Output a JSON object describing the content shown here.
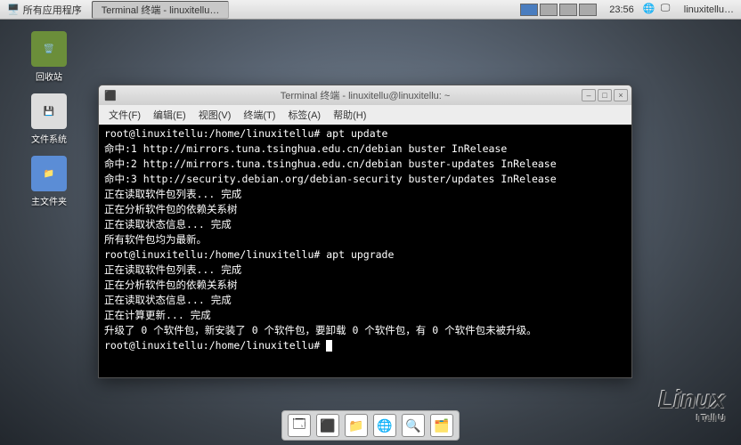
{
  "panel": {
    "apps_btn": "所有应用程序",
    "task": "Terminal 终端 - linuxitellu…",
    "clock": "23:56",
    "user": "linuxitellu…"
  },
  "desktop": {
    "trash": "回收站",
    "filesystem": "文件系统",
    "home": "主文件夹"
  },
  "window": {
    "title": "Terminal 终端 - linuxitellu@linuxitellu: ~",
    "menu": {
      "file": "文件(F)",
      "edit": "编辑(E)",
      "view": "视图(V)",
      "terminal": "终端(T)",
      "tabs": "标签(A)",
      "help": "帮助(H)"
    }
  },
  "term_lines": [
    "root@linuxitellu:/home/linuxitellu# apt update",
    "命中:1 http://mirrors.tuna.tsinghua.edu.cn/debian buster InRelease",
    "命中:2 http://mirrors.tuna.tsinghua.edu.cn/debian buster-updates InRelease",
    "命中:3 http://security.debian.org/debian-security buster/updates InRelease",
    "正在读取软件包列表... 完成",
    "正在分析软件包的依赖关系树",
    "正在读取状态信息... 完成",
    "所有软件包均为最新。",
    "root@linuxitellu:/home/linuxitellu# apt upgrade",
    "正在读取软件包列表... 完成",
    "正在分析软件包的依赖关系树",
    "正在读取状态信息... 完成",
    "正在计算更新... 完成",
    "升级了 0 个软件包，新安装了 0 个软件包，要卸载 0 个软件包，有 0 个软件包未被升级。",
    "root@linuxitellu:/home/linuxitellu# "
  ],
  "watermark": {
    "line1": "Linux",
    "line2": "I Tell U"
  }
}
